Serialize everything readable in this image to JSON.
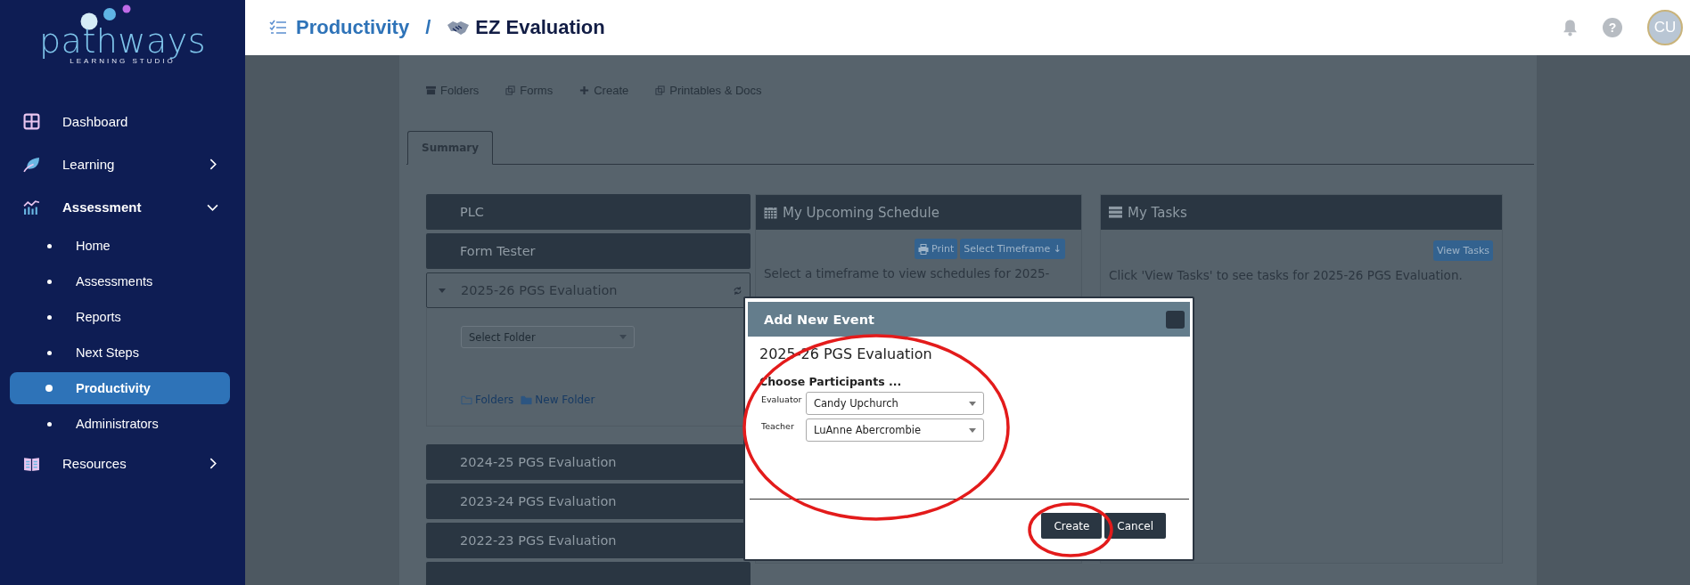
{
  "sidebar": {
    "logo": {
      "name": "pathways",
      "tagline": "LEARNING STUDIO"
    },
    "items": [
      {
        "label": "Dashboard",
        "kind": "link"
      },
      {
        "label": "Learning",
        "kind": "group",
        "expanded": false
      },
      {
        "label": "Assessment",
        "kind": "group",
        "expanded": true,
        "children": [
          {
            "label": "Home",
            "selected": false
          },
          {
            "label": "Assessments",
            "selected": false
          },
          {
            "label": "Reports",
            "selected": false
          },
          {
            "label": "Next Steps",
            "selected": false
          },
          {
            "label": "Productivity",
            "selected": true
          },
          {
            "label": "Administrators",
            "selected": false
          }
        ]
      },
      {
        "label": "Resources",
        "kind": "group",
        "expanded": false
      }
    ]
  },
  "header": {
    "breadcrumb": [
      "Productivity",
      "EZ Evaluation"
    ],
    "separator": "/",
    "help": "?",
    "avatar": "CU"
  },
  "toolbar": [
    "Folders",
    "Forms",
    "Create",
    "Printables & Docs"
  ],
  "tabs": [
    {
      "label": "Summary",
      "selected": true
    }
  ],
  "evaluations": [
    {
      "title": "PLC",
      "expanded": false
    },
    {
      "title": "Form Tester",
      "expanded": false
    },
    {
      "title": "2025-26 PGS Evaluation",
      "expanded": true,
      "folder_select": {
        "placeholder": "Select Folder"
      },
      "links": [
        "Folders",
        "New Folder"
      ]
    },
    {
      "title": "2024-25 PGS Evaluation",
      "expanded": false
    },
    {
      "title": "2023-24 PGS Evaluation",
      "expanded": false
    },
    {
      "title": "2022-23 PGS Evaluation",
      "expanded": false
    }
  ],
  "schedule": {
    "title": "My Upcoming Schedule",
    "buttons": [
      "Print",
      "Select Timeframe ↓"
    ],
    "text": "Select a timeframe to view schedules for 2025-"
  },
  "tasks": {
    "title": "My Tasks",
    "buttons": [
      "View Tasks"
    ],
    "text": "Click 'View Tasks' to see tasks for 2025-26 PGS Evaluation."
  },
  "modal": {
    "title": "Add New Event",
    "subtitle": "2025-26 PGS Evaluation",
    "section": "Choose Participants ...",
    "fields": [
      {
        "label": "Evaluator",
        "value": "Candy Upchurch"
      },
      {
        "label": "Teacher",
        "value": "LuAnne Abercrombie"
      }
    ],
    "buttons": [
      "Create",
      "Cancel"
    ]
  }
}
